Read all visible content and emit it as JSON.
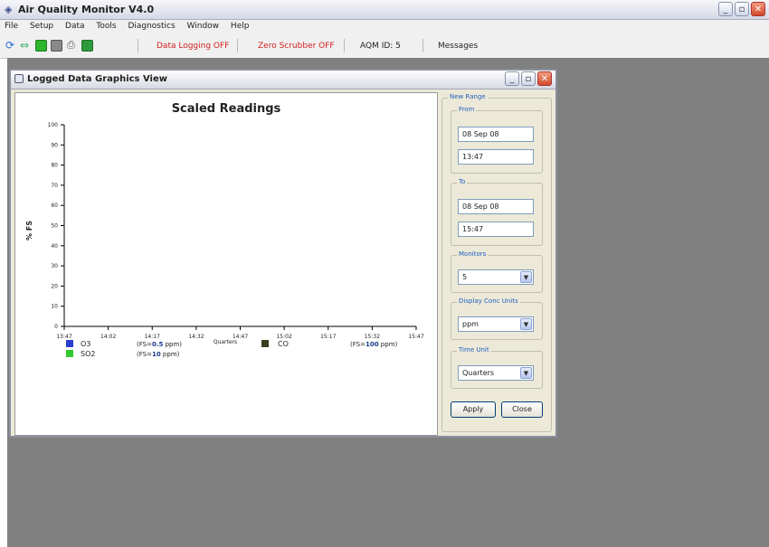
{
  "app": {
    "title": "Air Quality Monitor V4.0",
    "menu": [
      "File",
      "Setup",
      "Data",
      "Tools",
      "Diagnostics",
      "Window",
      "Help"
    ],
    "toolbar": {
      "data_logging": "Data Logging OFF",
      "zero_scrubber": "Zero Scrubber OFF",
      "aqm_id": "AQM ID: 5",
      "messages": "Messages"
    }
  },
  "window": {
    "title": "Logged Data Graphics View"
  },
  "chart_data": {
    "type": "line",
    "title": "Scaled Readings",
    "ylabel": "% FS",
    "xlabel": "Quarters",
    "ylim": [
      0,
      100
    ],
    "yticks": [
      "0",
      "10",
      "20",
      "30",
      "40",
      "50",
      "60",
      "70",
      "80",
      "90",
      "100"
    ],
    "categories": [
      "13:47",
      "14:02",
      "14:17",
      "14:32",
      "14:47",
      "15:02",
      "15:17",
      "15:32",
      "15:47"
    ],
    "series": [
      {
        "name": "O3",
        "color": "#2a3fd1",
        "fs_prefix": "(FS=",
        "fs": "0.5",
        "fs_suffix": " ppm)",
        "values": []
      },
      {
        "name": "SO2",
        "color": "#32c832",
        "fs_prefix": "(FS=",
        "fs": "10",
        "fs_suffix": " ppm)",
        "values": []
      },
      {
        "name": "CO",
        "color": "#3d3d1e",
        "fs_prefix": "(FS=",
        "fs": "100",
        "fs_suffix": " ppm)",
        "values": []
      }
    ]
  },
  "side": {
    "new_range": "New Range",
    "from_label": "From",
    "from_date": "08 Sep 08",
    "from_time": "13:47",
    "to_label": "To",
    "to_date": "08 Sep 08",
    "to_time": "15:47",
    "monitors_label": "Monitors",
    "monitors_value": "5",
    "units_label": "Display Conc Units",
    "units_value": "ppm",
    "time_unit_label": "Time Unit",
    "time_unit_value": "Quarters",
    "apply": "Apply",
    "close": "Close"
  },
  "colors": {
    "desktop": "#808080",
    "window_bg": "#ece9d8",
    "accent": "#1f5fbf",
    "alert": "#d22020"
  }
}
